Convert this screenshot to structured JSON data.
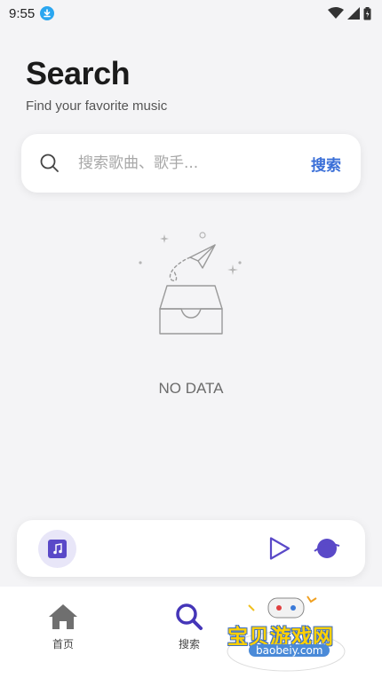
{
  "status_bar": {
    "time": "9:55"
  },
  "header": {
    "title": "Search",
    "subtitle": "Find your favorite music"
  },
  "search": {
    "placeholder": "搜索歌曲、歌手...",
    "value": "",
    "button_label": "搜索"
  },
  "empty_state": {
    "text": "NO DATA"
  },
  "player": {
    "cover_icon": "music-note-icon",
    "play_icon": "play-icon",
    "playlist_icon": "playlist-icon"
  },
  "bottom_nav": {
    "items": [
      {
        "label": "首页",
        "icon": "home-icon",
        "active": false
      },
      {
        "label": "搜索",
        "icon": "search-icon",
        "active": true
      }
    ]
  },
  "watermark": {
    "title": "宝贝游戏网",
    "url": "baobeiy.com"
  },
  "colors": {
    "accent": "#3a6fd8",
    "player_purple": "#5a49c8",
    "background": "#f4f4f6"
  }
}
